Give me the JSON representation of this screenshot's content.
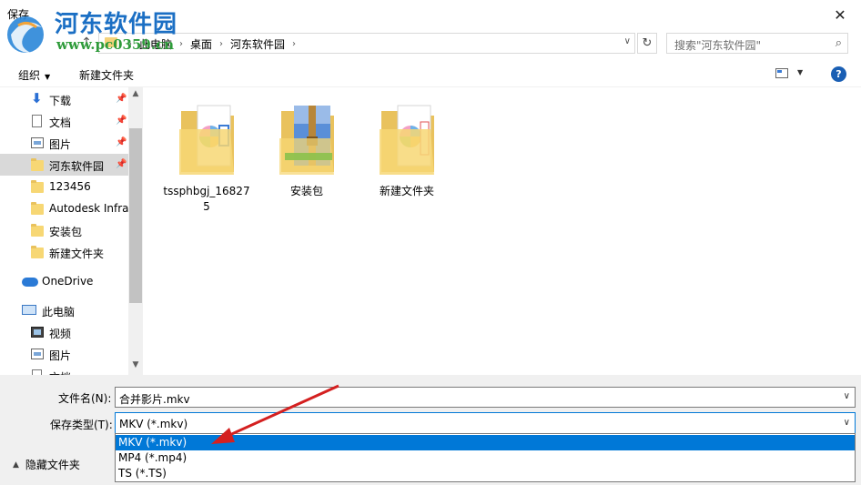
{
  "window": {
    "title": "保存",
    "close_glyph": "✕"
  },
  "watermark": {
    "brand": "河东软件园",
    "url": "www.pc0359.cn"
  },
  "address_bar": {
    "breadcrumbs": [
      "此电脑",
      "桌面",
      "河东软件园"
    ],
    "separator": "›",
    "search_placeholder": "搜索\"河东软件园\""
  },
  "toolbar": {
    "organize_label": "组织",
    "new_folder_label": "新建文件夹",
    "help_glyph": "?"
  },
  "nav": {
    "items": [
      {
        "label": "下载",
        "icon": "download-arrow-icon",
        "pinned": true
      },
      {
        "label": "文档",
        "icon": "document-icon",
        "pinned": true
      },
      {
        "label": "图片",
        "icon": "pictures-icon",
        "pinned": true
      },
      {
        "label": "河东软件园",
        "icon": "folder-icon",
        "pinned": true,
        "selected": true
      },
      {
        "label": "123456",
        "icon": "folder-icon"
      },
      {
        "label": "Autodesk Infra",
        "icon": "folder-icon"
      },
      {
        "label": "安装包",
        "icon": "folder-icon"
      },
      {
        "label": "新建文件夹",
        "icon": "folder-icon"
      },
      {
        "label": "OneDrive",
        "icon": "onedrive-cloud-icon"
      },
      {
        "label": "此电脑",
        "icon": "this-pc-icon"
      },
      {
        "label": "视频",
        "icon": "video-icon"
      },
      {
        "label": "图片",
        "icon": "pictures-icon"
      },
      {
        "label": "文档",
        "icon": "document-icon"
      }
    ]
  },
  "files": [
    {
      "label": "tssphbgj_168275",
      "icon": "folder-with-media-icon"
    },
    {
      "label": "安装包",
      "icon": "folder-with-archive-icon"
    },
    {
      "label": "新建文件夹",
      "icon": "folder-with-media-icon"
    }
  ],
  "save": {
    "filename_label": "文件名(N):",
    "filename_value": "合并影片.mkv",
    "filetype_label": "保存类型(T):",
    "filetype_value": "MKV (*.mkv)",
    "filetype_options": [
      "MKV (*.mkv)",
      "MP4 (*.mp4)",
      "TS (*.TS)"
    ],
    "selected_option_index": 0,
    "hide_folders_label": "隐藏文件夹"
  },
  "colors": {
    "accent": "#0078d7",
    "annotation_arrow": "#d42020",
    "watermark_blue": "#1b6fc4",
    "watermark_green": "#2e9b3a"
  }
}
